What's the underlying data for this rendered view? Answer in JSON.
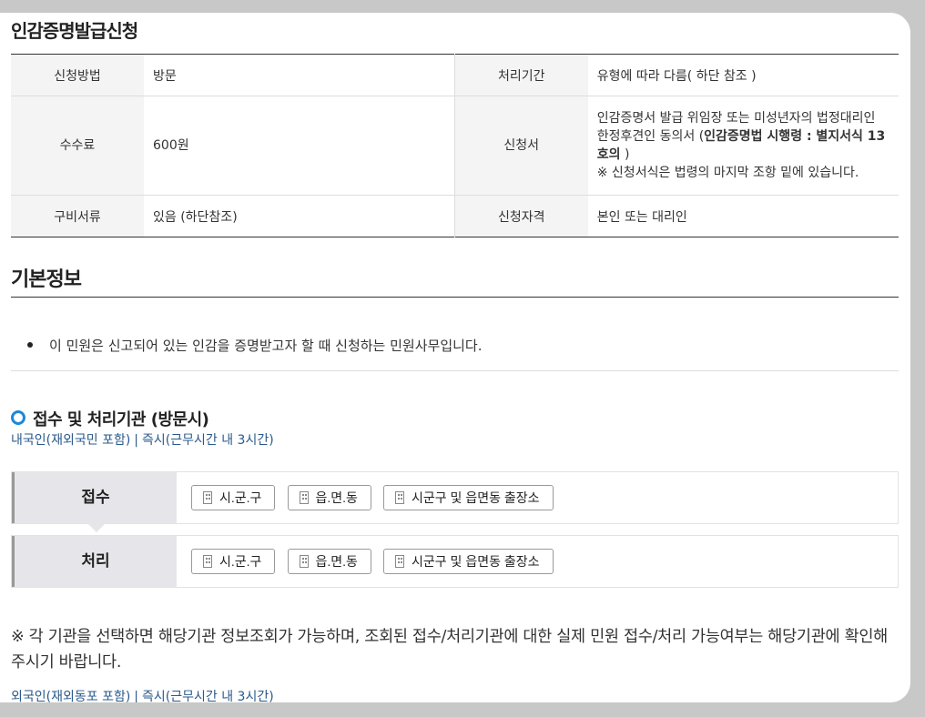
{
  "page_title": "인감증명발급신청",
  "info": {
    "method_label": "신청방법",
    "method_value": "방문",
    "period_label": "처리기간",
    "period_value": "유형에 따라 다름( 하단 참조 )",
    "fee_label": "수수료",
    "fee_value": "600원",
    "form_label": "신청서",
    "form_value_1": "인감증명서 발급 위임장 또는 미성년자의 법정대리인 한정후견인 동의서 (",
    "form_value_bold": "인감증명법 시행령 : 별지서식 13호의",
    "form_value_2": " )",
    "form_value_note": "※ 신청서식은 법령의 마지막 조항 밑에 있습니다.",
    "docs_label": "구비서류",
    "docs_value": "있음 (하단참조)",
    "qual_label": "신청자격",
    "qual_value": "본인 또는 대리인"
  },
  "basic_info": {
    "title": "기본정보",
    "bullet": "이 민원은 신고되어 있는 인감을 증명받고자 할 때 신청하는 민원사무입니다."
  },
  "processing": {
    "heading": "접수 및 처리기관 (방문시)",
    "domestic_link": "내국인(재외국민 포함)",
    "domestic_time": "즉시(근무시간 내 3시간)",
    "separator": "|",
    "receive_label": "접수",
    "process_label": "처리",
    "agency_1": "시.군.구",
    "agency_2": "읍.면.동",
    "agency_3": "시군구 및 읍면동 출장소",
    "notice": "※ 각 기관을 선택하면 해당기관 정보조회가 가능하며, 조회된 접수/처리기관에 대한 실제 민원 접수/처리 가능여부는 해당기관에 확인해 주시기 바랍니다.",
    "foreign_link": "외국인(재외동포 포함)",
    "foreign_time": "즉시(근무시간 내 3시간)"
  },
  "colors": {
    "accent": "#1e88d8",
    "link": "#2a5a8c",
    "header_bg": "#e6e6ea"
  }
}
